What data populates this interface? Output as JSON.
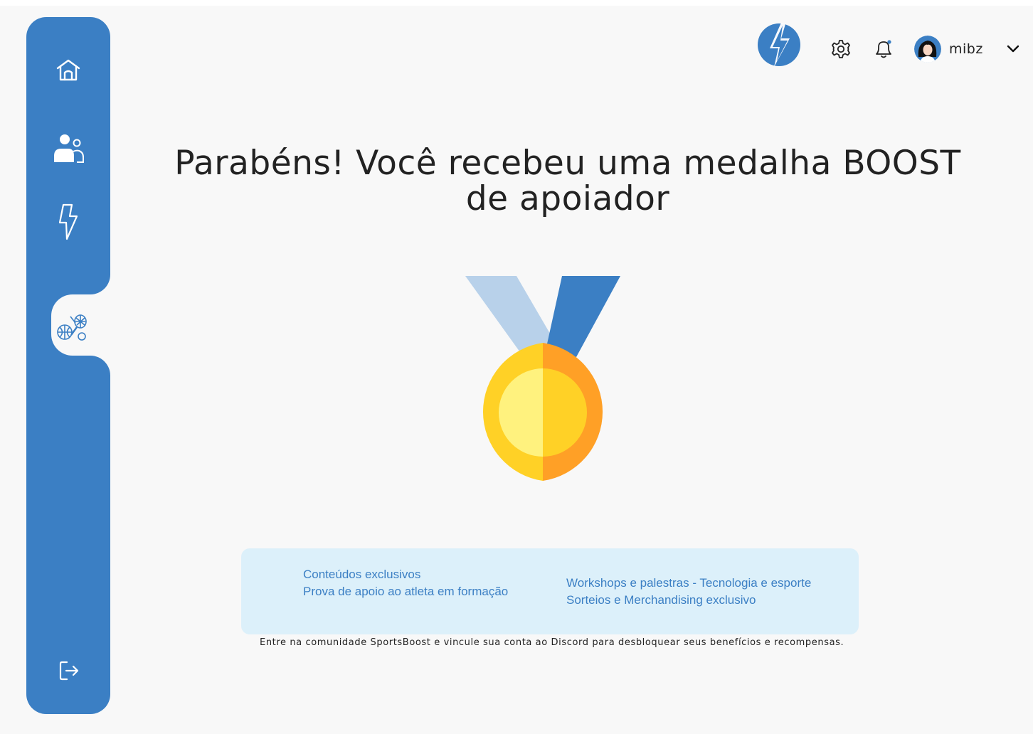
{
  "header": {
    "username": "mibz",
    "icons": [
      "bolt-logo-icon",
      "gear-icon",
      "bell-icon",
      "avatar",
      "chevron-down-icon"
    ]
  },
  "sidebar": {
    "items": [
      {
        "name": "home-icon"
      },
      {
        "name": "users-icon"
      },
      {
        "name": "bolt-icon"
      },
      {
        "name": "sports-icon",
        "active": true
      },
      {
        "name": "logout-icon"
      }
    ]
  },
  "main": {
    "headline_line1": "Parabéns! Você recebeu uma medalha BOOST",
    "headline_line2": "de apoiador",
    "benefits": {
      "left": [
        "Conteúdos exclusivos",
        "Prova de apoio ao atleta em formação"
      ],
      "right": [
        "Workshops e palestras - Tecnologia e esporte",
        "Sorteios e Merchandising exclusivo"
      ]
    },
    "footnote": "Entre na comunidade SportsBoost e vincule sua conta ao Discord para desbloquear seus benefícios e recompensas."
  },
  "colors": {
    "primary": "#3b7fc4",
    "background": "#f8f8f8",
    "benefits_bg": "#dcf0fa",
    "medal_gold": "#ffd126",
    "medal_orange": "#ffa026"
  }
}
